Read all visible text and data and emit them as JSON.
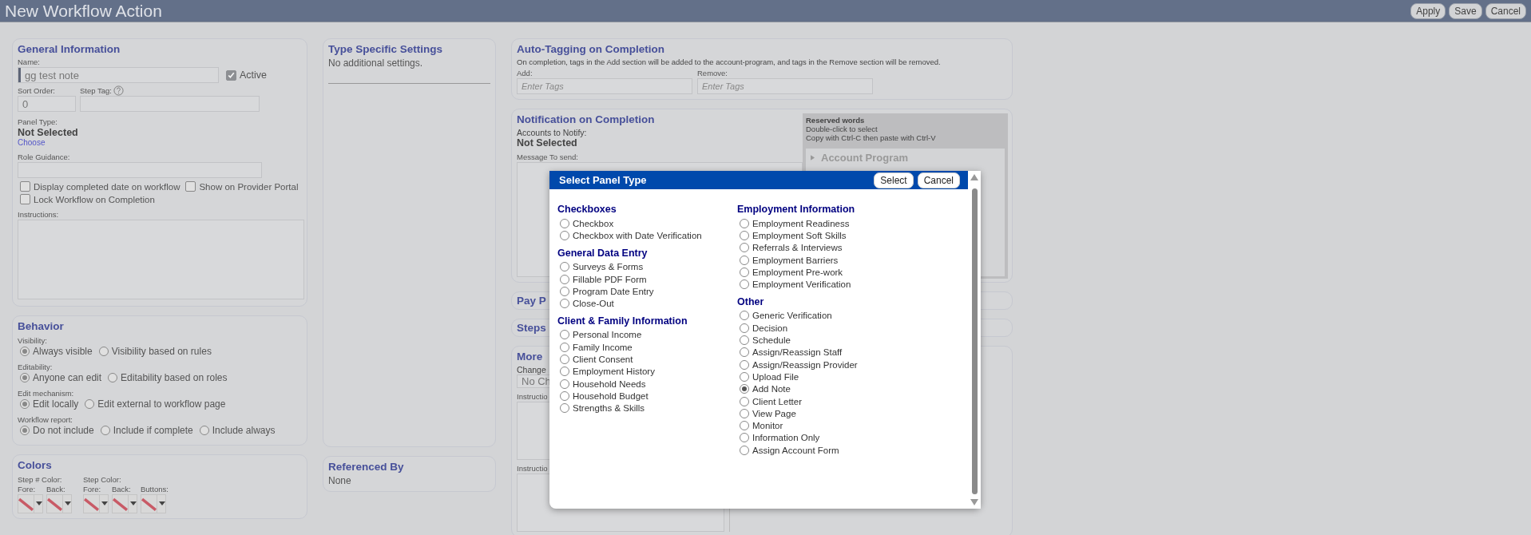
{
  "window": {
    "title": "New Workflow Action"
  },
  "toolbar": {
    "buttons": [
      "Apply",
      "Save",
      "Cancel"
    ]
  },
  "general_information": {
    "title": "General Information",
    "name_label": "Name:",
    "name_value": "gg test note",
    "active": {
      "label": "Active",
      "checked": true
    },
    "sort_order_label": "Sort Order:",
    "sort_order_value": "0",
    "step_tag_label": "Step Tag:",
    "panel_type_label": "Panel Type:",
    "panel_type_value": "Not Selected",
    "choose_link": "Choose",
    "role_guidance_label": "Role Guidance:",
    "options": [
      {
        "label": "Display completed date on workflow",
        "checked": false
      },
      {
        "label": "Show on Provider Portal",
        "checked": false
      },
      {
        "label": "Lock Workflow on Completion",
        "checked": false
      }
    ],
    "instructions_label": "Instructions:"
  },
  "behavior": {
    "title": "Behavior",
    "groups": [
      {
        "label": "Visibility:",
        "options": [
          {
            "label": "Always visible",
            "selected": true
          },
          {
            "label": "Visibility based on rules",
            "selected": false
          }
        ]
      },
      {
        "label": "Editability:",
        "options": [
          {
            "label": "Anyone can edit",
            "selected": true
          },
          {
            "label": "Editability based on roles",
            "selected": false
          }
        ]
      },
      {
        "label": "Edit mechanism:",
        "options": [
          {
            "label": "Edit locally",
            "selected": true
          },
          {
            "label": "Edit external to workflow page",
            "selected": false
          }
        ]
      },
      {
        "label": "Workflow report:",
        "options": [
          {
            "label": "Do not include",
            "selected": true
          },
          {
            "label": "Include if complete",
            "selected": false
          },
          {
            "label": "Include always",
            "selected": false
          }
        ]
      }
    ]
  },
  "colors": {
    "title": "Colors",
    "groups": [
      {
        "label": "Step # Color:",
        "pickers": [
          "Fore:",
          "Back:"
        ]
      },
      {
        "label": "Step Color:",
        "pickers": [
          "Fore:",
          "Back:",
          "Buttons:"
        ]
      }
    ]
  },
  "type_specific_settings": {
    "title": "Type Specific Settings",
    "text": "No additional settings."
  },
  "referenced_by": {
    "title": "Referenced By",
    "text": "None"
  },
  "auto_tagging": {
    "title": "Auto-Tagging on Completion",
    "description": "On completion, tags in the Add section will be added to the account-program, and tags in the Remove section will be removed.",
    "fields": [
      {
        "label": "Add:",
        "placeholder": "Enter Tags"
      },
      {
        "label": "Remove:",
        "placeholder": "Enter Tags"
      }
    ]
  },
  "notification": {
    "title": "Notification on Completion",
    "accounts_label": "Accounts to Notify:",
    "accounts_value": "Not Selected",
    "message_label": "Message To send:",
    "reserved_words": {
      "title": "Reserved words",
      "lines": [
        "Double-click to select",
        "Copy with Ctrl-C then paste with Ctrl-V"
      ],
      "items": [
        "Account Program"
      ]
    }
  },
  "collapsed_panels": [
    "Pay P",
    "Steps"
  ],
  "more_settings": {
    "title": "More",
    "change_label": "Change",
    "select_value": "No Ch",
    "instructions_labels": [
      "Instructio",
      "Instructio"
    ]
  },
  "dialog": {
    "title": "Select Panel Type",
    "buttons": [
      "Select",
      "Cancel"
    ],
    "columns": [
      [
        {
          "heading": "Checkboxes",
          "options": [
            {
              "label": "Checkbox",
              "selected": false
            },
            {
              "label": "Checkbox with Date Verification",
              "selected": false
            }
          ]
        },
        {
          "heading": "General Data Entry",
          "options": [
            {
              "label": "Surveys & Forms",
              "selected": false
            },
            {
              "label": "Fillable PDF Form",
              "selected": false
            },
            {
              "label": "Program Date Entry",
              "selected": false
            },
            {
              "label": "Close-Out",
              "selected": false
            }
          ]
        },
        {
          "heading": "Client & Family Information",
          "options": [
            {
              "label": "Personal Income",
              "selected": false
            },
            {
              "label": "Family Income",
              "selected": false
            },
            {
              "label": "Client Consent",
              "selected": false
            },
            {
              "label": "Employment History",
              "selected": false
            },
            {
              "label": "Household Needs",
              "selected": false
            },
            {
              "label": "Household Budget",
              "selected": false
            },
            {
              "label": "Strengths & Skills",
              "selected": false
            }
          ]
        }
      ],
      [
        {
          "heading": "Employment Information",
          "options": [
            {
              "label": "Employment Readiness",
              "selected": false
            },
            {
              "label": "Employment Soft Skills",
              "selected": false
            },
            {
              "label": "Referrals & Interviews",
              "selected": false
            },
            {
              "label": "Employment Barriers",
              "selected": false
            },
            {
              "label": "Employment Pre-work",
              "selected": false
            },
            {
              "label": "Employment Verification",
              "selected": false
            }
          ]
        },
        {
          "heading": "Other",
          "options": [
            {
              "label": "Generic Verification",
              "selected": false
            },
            {
              "label": "Decision",
              "selected": false
            },
            {
              "label": "Schedule",
              "selected": false
            },
            {
              "label": "Assign/Reassign Staff",
              "selected": false
            },
            {
              "label": "Assign/Reassign Provider",
              "selected": false
            },
            {
              "label": "Upload File",
              "selected": false
            },
            {
              "label": "Add Note",
              "selected": true
            },
            {
              "label": "Client Letter",
              "selected": false
            },
            {
              "label": "View Page",
              "selected": false
            },
            {
              "label": "Monitor",
              "selected": false
            },
            {
              "label": "Information Only",
              "selected": false
            },
            {
              "label": "Assign Account Form",
              "selected": false
            }
          ]
        }
      ]
    ]
  }
}
